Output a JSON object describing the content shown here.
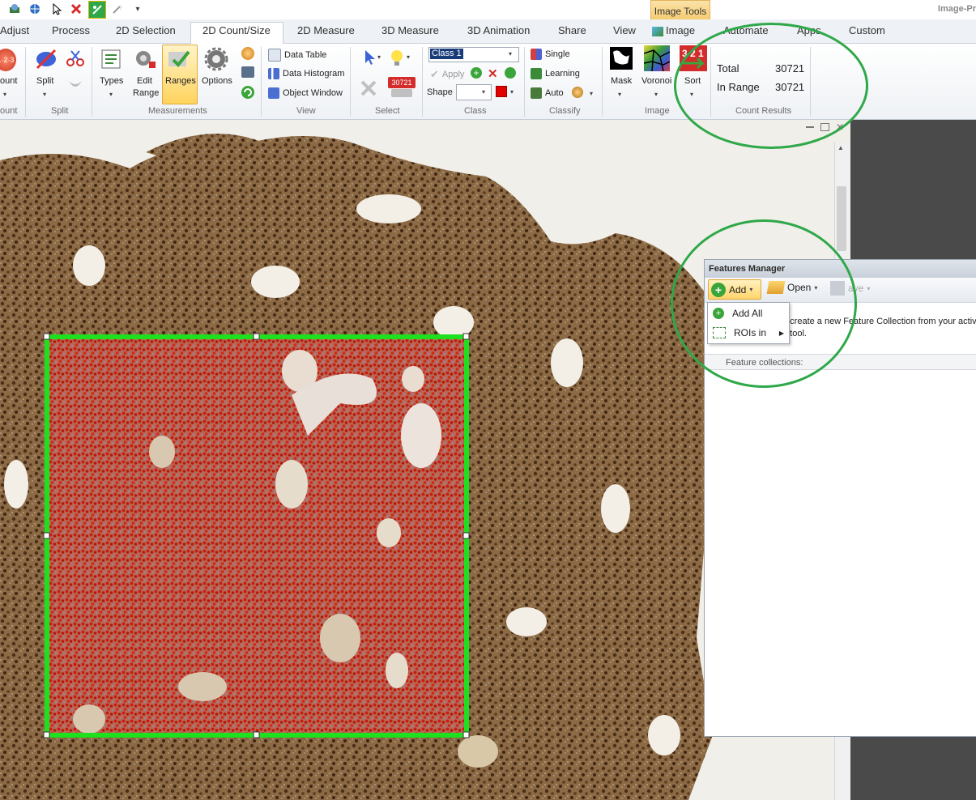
{
  "app": {
    "title": "Image-Pr",
    "context_tab": "Image Tools"
  },
  "tabs": [
    "Adjust",
    "Process",
    "2D Selection",
    "2D Count/Size",
    "2D Measure",
    "3D Measure",
    "3D Animation",
    "Share",
    "View",
    "Image",
    "Automate",
    "Apps",
    "Custom"
  ],
  "ribbon": {
    "count_group": {
      "button": "ount",
      "label": "ount"
    },
    "split_group": {
      "button": "Split",
      "label": "Split"
    },
    "measurements": {
      "types": "Types",
      "edit_range_1": "Edit",
      "edit_range_2": "Range",
      "ranges": "Ranges",
      "options": "Options",
      "label": "Measurements"
    },
    "view": {
      "data_table": "Data Table",
      "data_histogram": "Data Histogram",
      "object_window": "Object Window",
      "label": "View"
    },
    "select": {
      "badge": "30721",
      "label": "Select"
    },
    "class": {
      "value": "Class 1",
      "apply": "Apply",
      "shape": "Shape",
      "label": "Class"
    },
    "classify": {
      "single": "Single",
      "learning": "Learning",
      "auto": "Auto",
      "label": "Classify"
    },
    "image": {
      "mask": "Mask",
      "voronoi": "Voronoi",
      "sort": "Sort",
      "label": "Image"
    },
    "count_results": {
      "total_label": "Total",
      "total_value": "30721",
      "in_range_label": "In Range",
      "in_range_value": "30721",
      "label": "Count Results"
    }
  },
  "features_manager": {
    "title": "Features Manager",
    "add": "Add",
    "open": "Open",
    "save": "ave",
    "menu": {
      "add_all": "Add All",
      "rois_in": "ROIs in"
    },
    "hint_line1": "o create a new Feature Collection from your activ",
    "hint_line2": "d tool.",
    "collections_header": "Feature collections:"
  },
  "colors": {
    "roi_border": "#1ee01e",
    "overlay": "#c8321e",
    "annotation_ring": "#2fa84a",
    "tissue": "#8b6a45"
  }
}
